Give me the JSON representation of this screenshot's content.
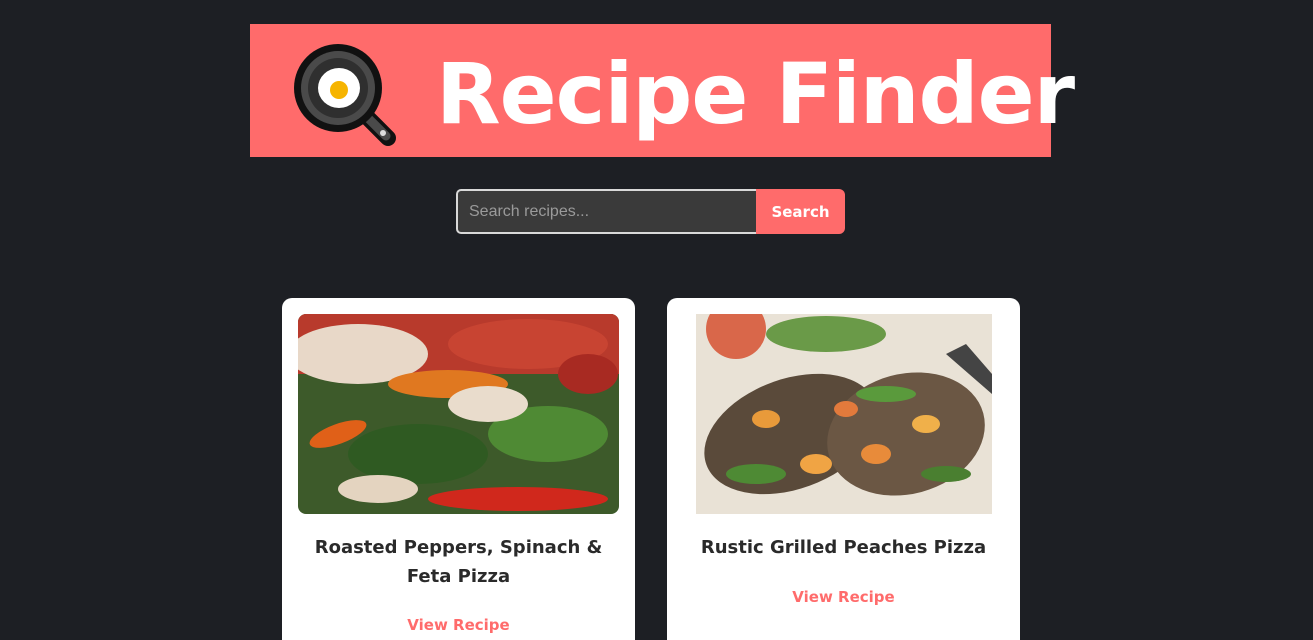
{
  "header": {
    "title": "Recipe Finder",
    "logo_icon": "frying-pan-egg-icon"
  },
  "search": {
    "placeholder": "Search recipes...",
    "value": "",
    "button_label": "Search"
  },
  "recipes": [
    {
      "title": "Roasted Peppers, Spinach & Feta Pizza",
      "link_label": "View Recipe"
    },
    {
      "title": "Rustic Grilled Peaches Pizza",
      "link_label": "View Recipe"
    }
  ],
  "colors": {
    "background": "#1d1f24",
    "accent": "#ff6b6b",
    "card": "#ffffff"
  }
}
